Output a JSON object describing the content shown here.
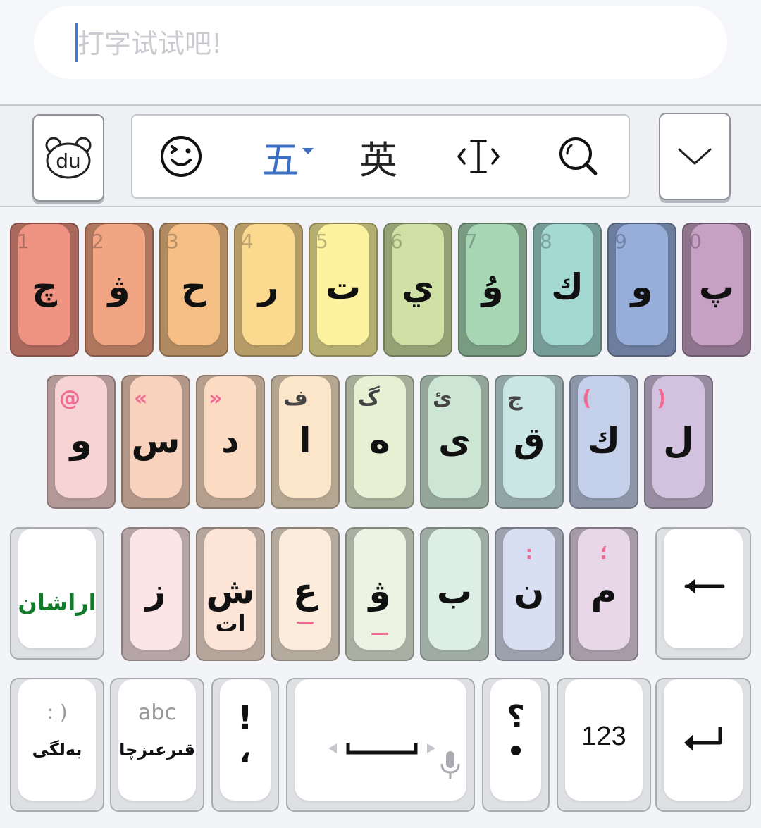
{
  "input": {
    "placeholder": "打字试试吧!"
  },
  "toolbar": {
    "logo_text": "du",
    "emoji_icon": "smiley-wink-icon",
    "ime_label": "五",
    "english_label": "英",
    "cursor_icon": "text-cursor-icon",
    "search_icon": "search-icon",
    "collapse_icon": "chevron-down-icon"
  },
  "rows": {
    "row1": [
      {
        "num": "1",
        "char": "چ",
        "color": "#ee9282"
      },
      {
        "num": "2",
        "char": "ۋ",
        "color": "#f2a583"
      },
      {
        "num": "3",
        "char": "ح",
        "color": "#f5bf86"
      },
      {
        "num": "4",
        "char": "ر",
        "color": "#fbd98f"
      },
      {
        "num": "5",
        "char": "ت",
        "color": "#fcf2a0"
      },
      {
        "num": "6",
        "char": "ي",
        "color": "#cfe1a4"
      },
      {
        "num": "7",
        "char": "ۇ",
        "color": "#a7d7b4"
      },
      {
        "num": "8",
        "char": "ك",
        "color": "#a4d8d3"
      },
      {
        "num": "9",
        "char": "و",
        "color": "#97aedb"
      },
      {
        "num": "0",
        "char": "پ",
        "color": "#c6a1c4"
      }
    ],
    "row2": [
      {
        "hint": "@",
        "char": "و",
        "color": "#f8d3d3",
        "pink": true
      },
      {
        "hint": "«",
        "char": "س",
        "color": "#f9d2bd",
        "pink": true
      },
      {
        "hint": "»",
        "char": "د",
        "color": "#fbdcc3",
        "pink": true
      },
      {
        "hint": "ف",
        "char": "ا",
        "color": "#fbe6c9",
        "pink": false
      },
      {
        "hint": "گ",
        "char": "ه",
        "color": "#e8f0d4",
        "pink": false
      },
      {
        "hint": "ئ",
        "char": "ى",
        "color": "#cde6d4",
        "pink": false
      },
      {
        "hint": "ج",
        "char": "ق",
        "color": "#c9e5e4",
        "pink": false
      },
      {
        "hint": "(",
        "char": "ك",
        "color": "#c4d0ea",
        "pink": true
      },
      {
        "hint": ")",
        "char": "ل",
        "color": "#d2c2df",
        "pink": true
      }
    ],
    "row3": [
      {
        "char": "ز",
        "color": "#fbe5e6",
        "sub": "",
        "dash": false
      },
      {
        "char": "ش",
        "color": "#fce5d6",
        "sub": "ات",
        "dash": false
      },
      {
        "char": "ع",
        "color": "#fcecdc",
        "sub": "",
        "dash": true
      },
      {
        "char": "ۋ",
        "color": "#edf3e3",
        "sub": "",
        "dash": true
      },
      {
        "char": "ب",
        "color": "#ddeee5",
        "sub": "",
        "dash": false
      },
      {
        "char": "ن",
        "color": "#d9dff2",
        "sub": ":",
        "dash": false
      },
      {
        "char": "م",
        "color": "#e7d7e8",
        "sub": "؛",
        "dash": false
      }
    ]
  },
  "special": {
    "shift_label": "اراشان",
    "backspace_icon": "backspace-arrow-icon",
    "symbols_top": ": )",
    "symbols_label": "بەلگى",
    "latin_top": "abc",
    "latin_label": "قىرعىزچا",
    "punct_top": "!",
    "punct_bottom": "،",
    "space_icon": "space-bar-icon",
    "mic_icon": "microphone-icon",
    "question_top": "؟",
    "question_bottom": "•",
    "numbers_label": "123",
    "enter_icon": "enter-return-icon"
  },
  "colors": {
    "ime_blue": "#3b6fc4",
    "shift_green": "#137a2a",
    "hint_pink": "#f06a93"
  }
}
